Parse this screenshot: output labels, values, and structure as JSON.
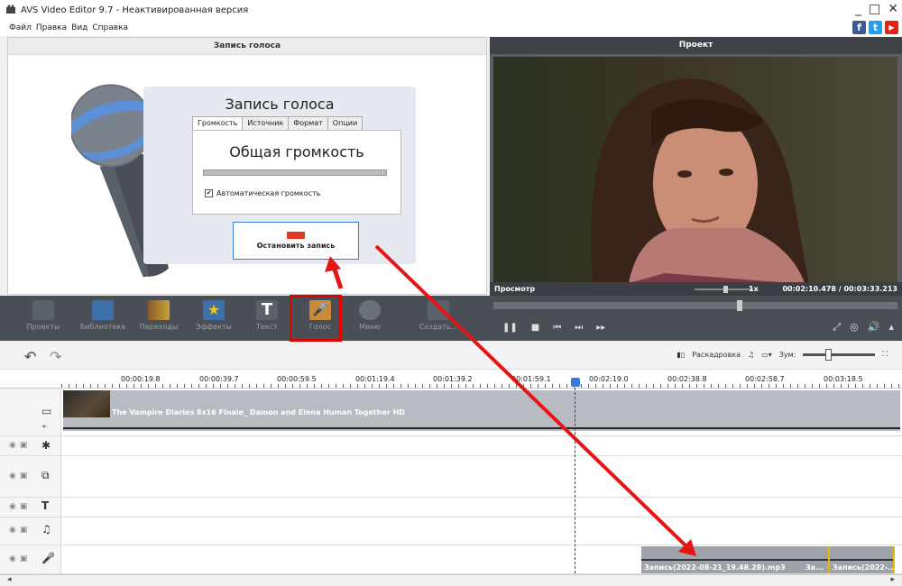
{
  "window": {
    "title": "AVS Video Editor 9.7 - Неактивированная версия",
    "controls": [
      "_",
      "□",
      "✕"
    ]
  },
  "menu": [
    "Файл",
    "Правка",
    "Вид",
    "Справка"
  ],
  "social": [
    {
      "name": "facebook-icon",
      "glyph": "f",
      "color": "#3b5998"
    },
    {
      "name": "twitter-icon",
      "glyph": "t",
      "color": "#1da1f2"
    },
    {
      "name": "youtube-icon",
      "glyph": "▶",
      "color": "#e62117"
    }
  ],
  "voice_panel": {
    "header": "Запись голоса",
    "title": "Запись голоса",
    "tabs": [
      "Громкость",
      "Источник",
      "Формат",
      "Опции"
    ],
    "volume_title": "Общая громкость",
    "auto_volume": "Автоматическая громкость",
    "auto_volume_checked": "✔",
    "stop_button": "Остановить запись"
  },
  "project_panel": {
    "header": "Проект",
    "preview_label": "Просмотр",
    "speed": "1x",
    "time": "00:02:10.478 / 00:03:33.213"
  },
  "toolbar": {
    "items": [
      {
        "name": "tool-projects",
        "label": "Проекты"
      },
      {
        "name": "tool-library",
        "label": "Библиотека"
      },
      {
        "name": "tool-transitions",
        "label": "Переходы"
      },
      {
        "name": "tool-effects",
        "label": "Эффекты"
      },
      {
        "name": "tool-text",
        "label": "Текст"
      },
      {
        "name": "tool-voice",
        "label": "Голос"
      },
      {
        "name": "tool-menu",
        "label": "Меню"
      },
      {
        "name": "tool-create",
        "label": "Создать..."
      }
    ]
  },
  "timeline": {
    "storyboard": "Раскадровка",
    "zoom_label": "Зум:",
    "ruler": [
      "00:00:19.8",
      "00:00:39.7",
      "00:00:59.5",
      "00:01:19.4",
      "00:01:39.2",
      "00:01:59.1",
      "00:02:19.0",
      "00:02:38.8",
      "00:02:58.7",
      "00:03:18.5"
    ],
    "video_clip": "The Vampire Diaries 8x16 Finale_ Damon and Elena Human Together HD",
    "audio_clips": [
      "Запись(2022-08-21_19.48.28).mp3",
      "За...",
      "Запись(2022-..."
    ]
  }
}
